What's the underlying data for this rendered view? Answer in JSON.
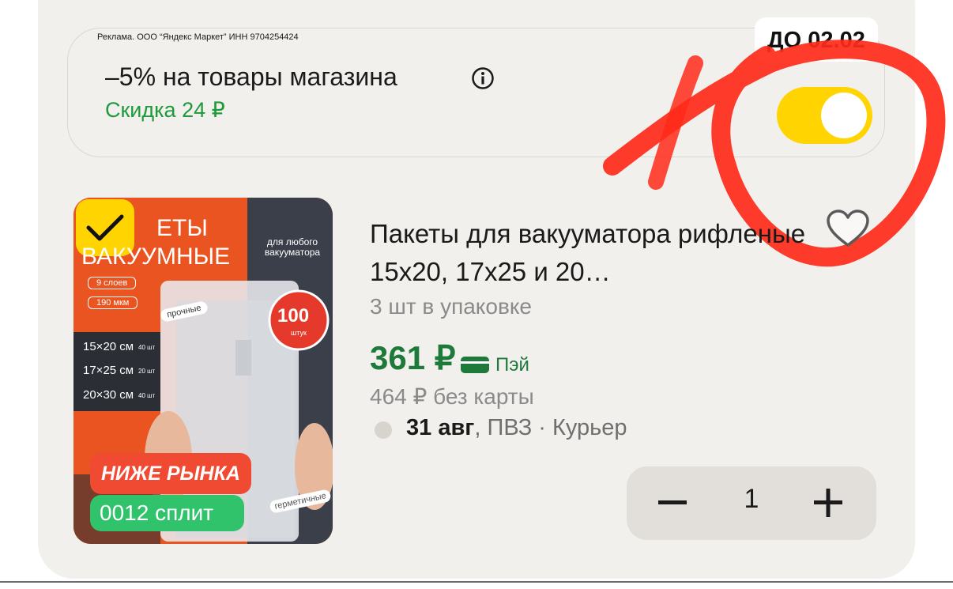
{
  "promo": {
    "ad_disclaimer": "Реклама. ООО “Яндекс Маркет” ИНН 9704254424",
    "deadline": "ДО 02.02",
    "title": "–5% на товары магазина",
    "discount": "Скидка 24 ₽",
    "toggle_on": true,
    "info_icon": "info-icon"
  },
  "product": {
    "image_texts": {
      "title_line1": "ЕТЫ",
      "title_line2": "ВАКУУМНЫЕ",
      "layers": "9 слоев",
      "thickness": "190 мкм",
      "strong": "прочные",
      "for_any": "для любого вакууматора",
      "count": "100",
      "count_unit": "штук",
      "size1": "15×20 см",
      "size1_qty": "40 шт",
      "size2": "17×25 см",
      "size2_qty": "20 шт",
      "size3": "20×30 см",
      "size3_qty": "40 шт",
      "hermetic": "герметичные"
    },
    "badges": {
      "below_market": "НИЖЕ РЫНКА",
      "split": "0012 сплит"
    },
    "title": "Пакеты для вакууматора рифленые 15х20, 17х25 и 20…",
    "pack": "3 шт в упаковке",
    "price": "361 ₽",
    "pay_label": "Пэй",
    "old_price": "464 ₽  без карты",
    "delivery_date": "31 авг",
    "delivery_rest": ", ПВЗ · Курьер",
    "quantity": "1"
  },
  "colors": {
    "accent_yellow": "#ffd400",
    "discount_green": "#1e9a3a",
    "price_green": "#1e7a3a",
    "scribble_red": "#ff2a1a",
    "card_bg": "#f2f0ed"
  }
}
